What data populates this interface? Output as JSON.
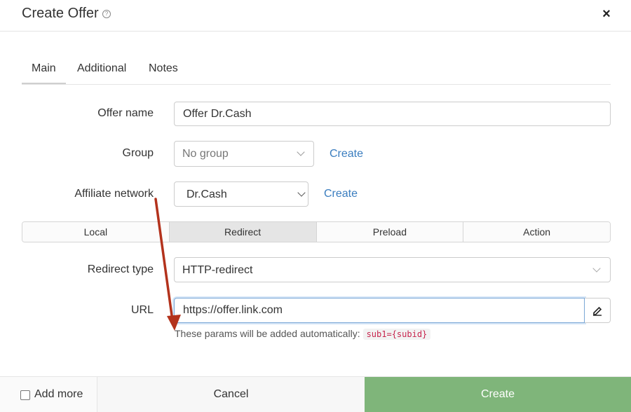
{
  "header": {
    "title": "Create Offer",
    "help_glyph": "?",
    "close_glyph": "×"
  },
  "tabs": [
    {
      "label": "Main",
      "active": true
    },
    {
      "label": "Additional",
      "active": false
    },
    {
      "label": "Notes",
      "active": false
    }
  ],
  "form": {
    "offer_name": {
      "label": "Offer name",
      "value": "Offer Dr.Cash"
    },
    "group": {
      "label": "Group",
      "value": "No group",
      "create_link": "Create"
    },
    "affiliate_network": {
      "label": "Affiliate network",
      "value": "Dr.Cash",
      "create_link": "Create"
    },
    "types": [
      {
        "label": "Local",
        "active": false
      },
      {
        "label": "Redirect",
        "active": true
      },
      {
        "label": "Preload",
        "active": false
      },
      {
        "label": "Action",
        "active": false
      }
    ],
    "redirect_type": {
      "label": "Redirect type",
      "value": "HTTP-redirect"
    },
    "url": {
      "label": "URL",
      "value": "https://offer.link.com",
      "hint": "These params will be added automatically:",
      "hint_code": "sub1={subid}"
    }
  },
  "footer": {
    "add_more_label": "Add more",
    "cancel_label": "Cancel",
    "create_label": "Create"
  },
  "colors": {
    "link": "#3a7dbf",
    "create_button": "#7fb57a",
    "arrow": "#b3321c",
    "code": "#c7254e"
  }
}
